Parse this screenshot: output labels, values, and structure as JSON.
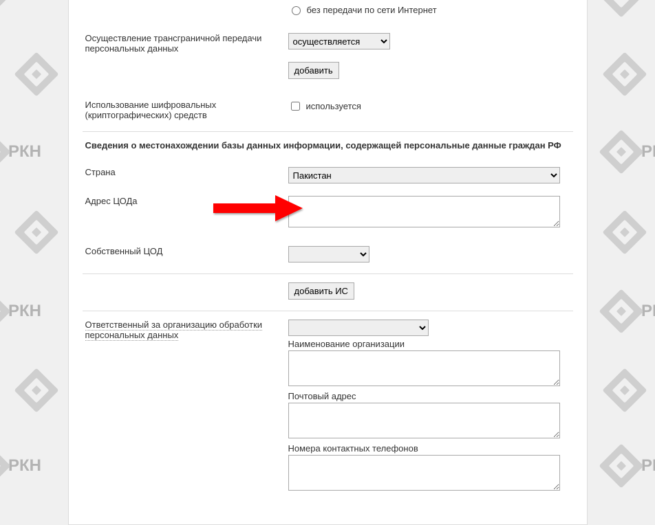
{
  "form": {
    "internet_radio": {
      "label": "без передачи по сети Интернет",
      "checked": false
    },
    "crossborder": {
      "label": "Осуществление трансграничной передачи персональных данных",
      "select_value": "осуществляется",
      "options": [
        "осуществляется"
      ],
      "add_button": "добавить"
    },
    "crypto": {
      "label": "Использование шифровальных (криптографических) средств",
      "checkbox_label": "используется",
      "checked": false
    },
    "db_location_heading": "Сведения о местонахождении базы данных информации, содержащей персональные данные граждан РФ",
    "country": {
      "label": "Страна",
      "value": "Пакистан",
      "options": [
        "Пакистан"
      ]
    },
    "dc_address": {
      "label": "Адрес ЦОДа",
      "value": ""
    },
    "own_dc": {
      "label": "Собственный ЦОД",
      "value": "",
      "options": [
        ""
      ]
    },
    "add_is_button": "добавить ИС",
    "responsible": {
      "label": "Ответственный за организацию обработки персональных данных",
      "org_select_value": "",
      "org_options": [
        ""
      ]
    },
    "org_name": {
      "caption": "Наименование организации",
      "value": ""
    },
    "post_addr": {
      "caption": "Почтовый адрес",
      "value": ""
    },
    "phones": {
      "caption": "Номера контактных телефонов",
      "value": ""
    }
  },
  "brand": {
    "text": "РКН"
  }
}
